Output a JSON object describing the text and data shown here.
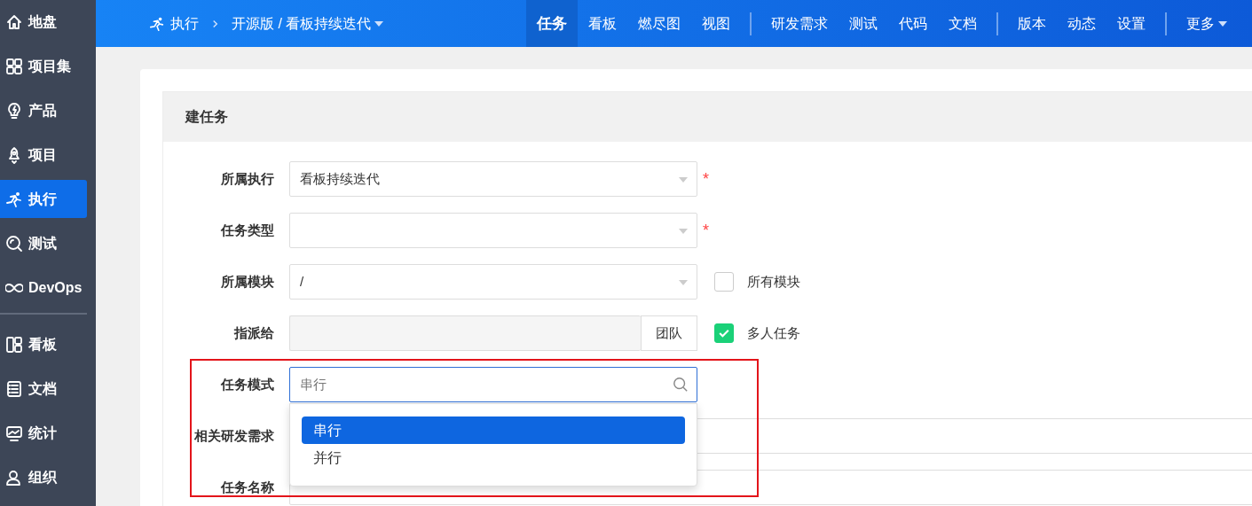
{
  "sidebar": {
    "groups": [
      [
        {
          "label": "地盘",
          "kind": "home",
          "selected": false
        },
        {
          "label": "项目集",
          "kind": "grid",
          "selected": false
        },
        {
          "label": "产品",
          "kind": "bulb",
          "selected": false
        },
        {
          "label": "项目",
          "kind": "rocket",
          "selected": false
        },
        {
          "label": "执行",
          "kind": "runner",
          "selected": true
        },
        {
          "label": "测试",
          "kind": "search",
          "selected": false
        },
        {
          "label": "DevOps",
          "kind": "infinity",
          "selected": false
        }
      ],
      [
        {
          "label": "看板",
          "kind": "kanban",
          "selected": false
        },
        {
          "label": "文档",
          "kind": "doc",
          "selected": false
        },
        {
          "label": "统计",
          "kind": "monitor",
          "selected": false
        },
        {
          "label": "组织",
          "kind": "user",
          "selected": false
        }
      ]
    ]
  },
  "topbar": {
    "module": "执行",
    "path": "开源版 / 看板持续迭代",
    "nav_groups": [
      [
        {
          "label": "任务",
          "selected": true
        },
        {
          "label": "看板",
          "selected": false
        },
        {
          "label": "燃尽图",
          "selected": false
        },
        {
          "label": "视图",
          "selected": false
        }
      ],
      [
        {
          "label": "研发需求",
          "selected": false
        },
        {
          "label": "测试",
          "selected": false
        },
        {
          "label": "代码",
          "selected": false
        },
        {
          "label": "文档",
          "selected": false
        }
      ],
      [
        {
          "label": "版本",
          "selected": false
        },
        {
          "label": "动态",
          "selected": false
        },
        {
          "label": "设置",
          "selected": false
        }
      ]
    ],
    "more": "更多"
  },
  "form": {
    "title": "建任务",
    "fields": [
      {
        "label": "所属执行",
        "kind": "select",
        "value": "看板持续迭代",
        "required_mark": "*"
      },
      {
        "label": "任务类型",
        "kind": "select",
        "required_mark": "*"
      },
      {
        "label": "所属模块",
        "kind": "select",
        "value": "/",
        "checkbox": {
          "label": "所有模块",
          "checked": false
        }
      },
      {
        "label": "指派给",
        "kind": "assign",
        "button": "团队",
        "checkbox": {
          "label": "多人任务",
          "checked": true
        }
      },
      {
        "label": "任务模式",
        "kind": "search",
        "placeholder": "串行",
        "options": [
          {
            "label": "串行",
            "selected": true
          },
          {
            "label": "并行",
            "selected": false
          }
        ]
      },
      {
        "label": "相关研发需求",
        "kind": "text"
      },
      {
        "label": "任务名称",
        "kind": "text"
      }
    ]
  }
}
